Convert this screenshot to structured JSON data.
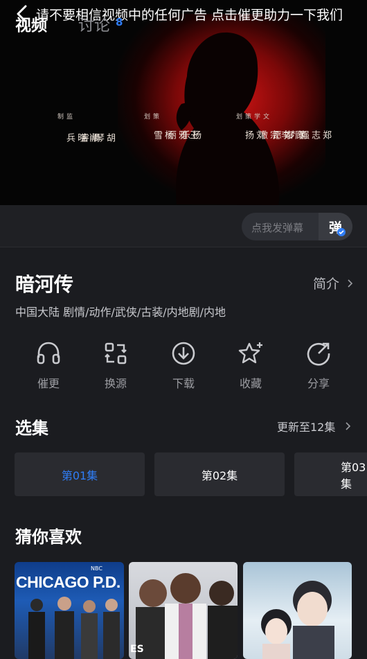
{
  "video": {
    "ticker": "请不要相信视频中的任何广告 点击催更助力一下我们",
    "credits": [
      {
        "role": "监制",
        "names": [
          "胡琴",
          "周睿",
          "肖晓兵"
        ]
      },
      {
        "role": "策划",
        "names": [
          "杨乐",
          "王雅丽",
          "杨雪"
        ]
      },
      {
        "role": "文学策划",
        "names": [
          "郑志强",
          "筑梦",
          "顾如愿",
          "李宗澈",
          "刘扬"
        ]
      }
    ]
  },
  "tabs": {
    "video_label": "视频",
    "discuss_label": "讨论",
    "discuss_count": "8",
    "danmu_placeholder": "点我发弹幕",
    "danmu_button": "弹"
  },
  "info": {
    "title": "暗河传",
    "intro_label": "简介",
    "tags": "中国大陆  剧情/动作/武侠/古装/内地剧/内地"
  },
  "actions": [
    {
      "label": "催更",
      "icon": "headphones-icon"
    },
    {
      "label": "换源",
      "icon": "switch-source-icon"
    },
    {
      "label": "下载",
      "icon": "download-icon"
    },
    {
      "label": "收藏",
      "icon": "star-icon"
    },
    {
      "label": "分享",
      "icon": "share-icon"
    }
  ],
  "episodes": {
    "title": "选集",
    "update": "更新至12集",
    "items": [
      "第01集",
      "第02集",
      "第03集"
    ],
    "selected_color": "#2f7df6"
  },
  "recommend": {
    "title": "猜你喜欢",
    "posters": [
      {
        "text": "CHICAGO P.D.",
        "badge": "NBC"
      },
      {
        "text": "ES"
      },
      {
        "text": ""
      }
    ]
  }
}
